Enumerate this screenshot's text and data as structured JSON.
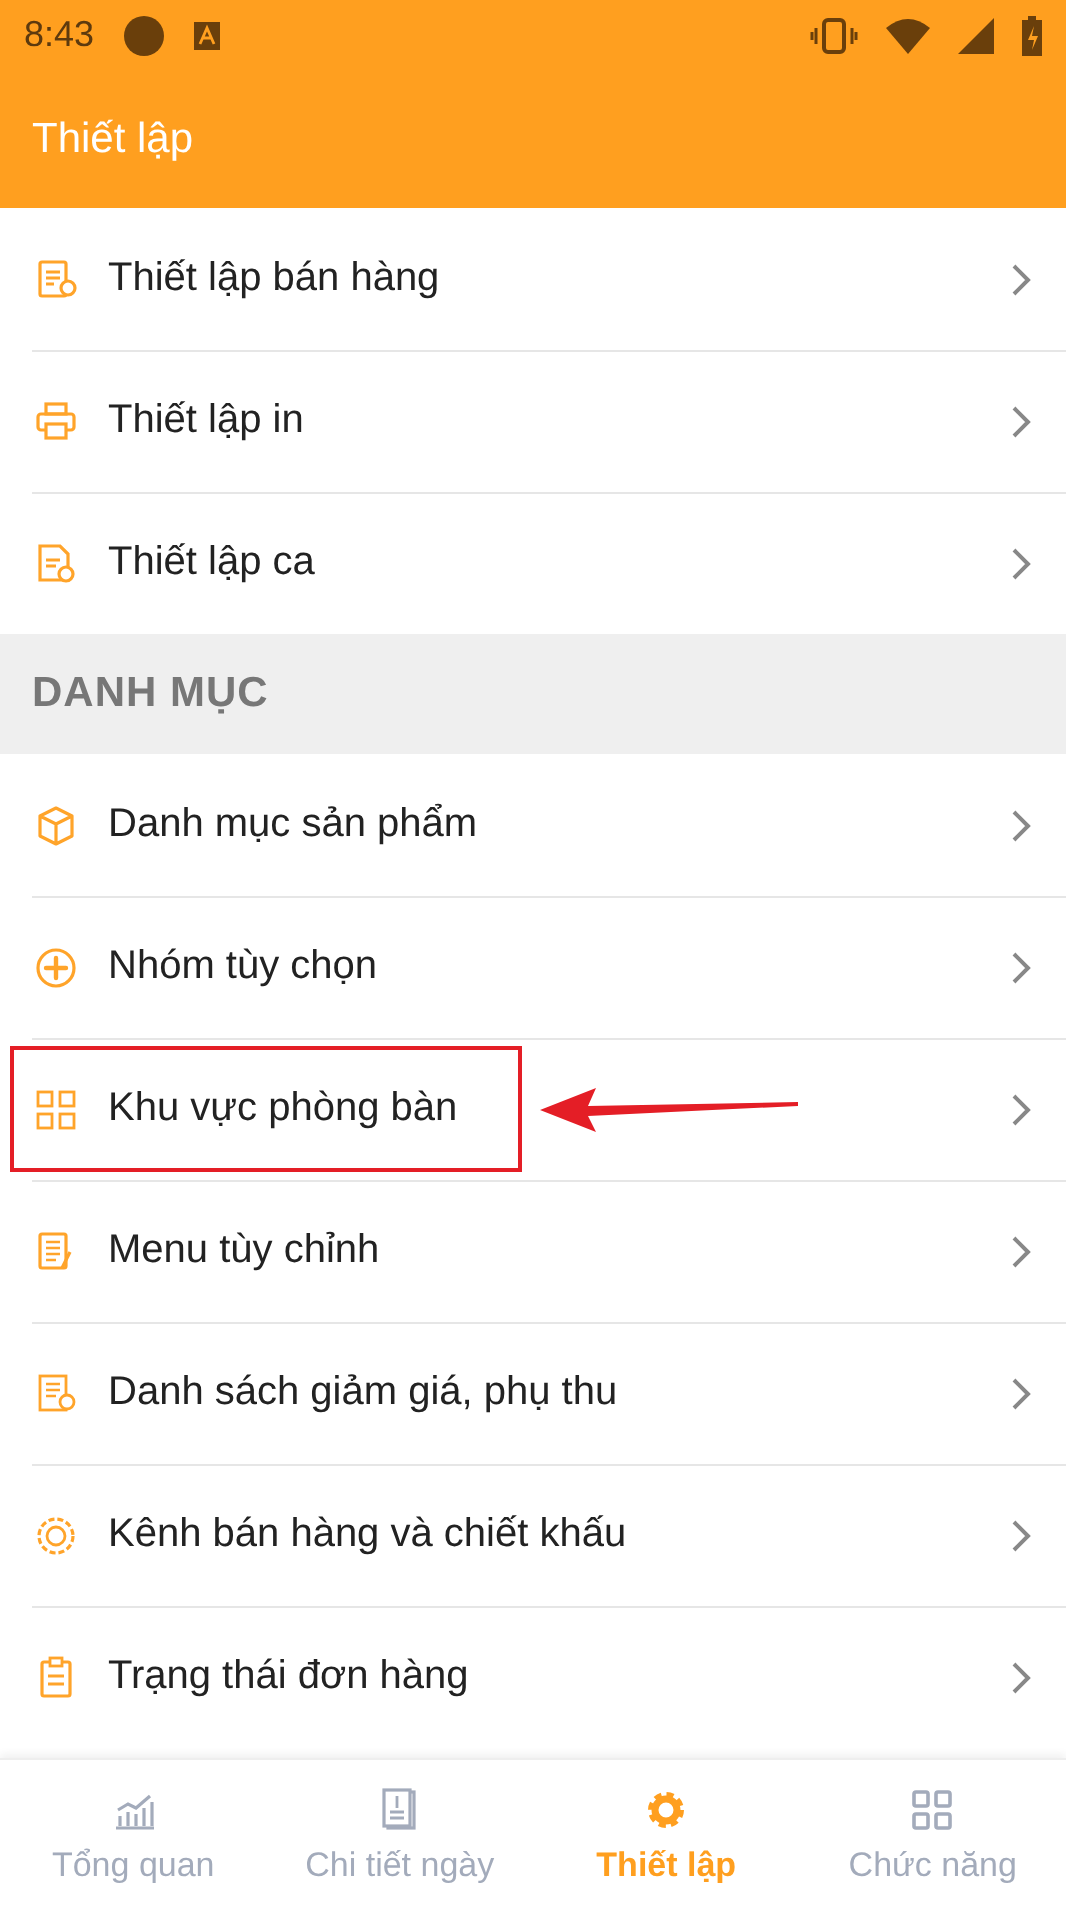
{
  "status_bar": {
    "time": "8:43"
  },
  "app_bar": {
    "title": "Thiết lập"
  },
  "sections": [
    {
      "items": [
        {
          "label": "Thiết lập bán hàng",
          "annotated": false
        },
        {
          "label": "Thiết lập in",
          "annotated": false
        },
        {
          "label": "Thiết lập ca",
          "annotated": false
        }
      ]
    },
    {
      "header": "DANH MỤC",
      "items": [
        {
          "label": "Danh mục sản phẩm",
          "annotated": false
        },
        {
          "label": "Nhóm tùy chọn",
          "annotated": false
        },
        {
          "label": "Khu vực phòng bàn",
          "annotated": true
        },
        {
          "label": "Menu tùy chỉnh",
          "annotated": false
        },
        {
          "label": "Danh sách giảm giá, phụ thu",
          "annotated": false
        },
        {
          "label": "Kênh bán hàng và chiết khấu",
          "annotated": false
        },
        {
          "label": "Trạng thái đơn hàng",
          "annotated": false
        }
      ]
    }
  ],
  "tabs": [
    {
      "label": "Tổng quan",
      "selected": false
    },
    {
      "label": "Chi tiết ngày",
      "selected": false
    },
    {
      "label": "Thiết lập",
      "selected": true
    },
    {
      "label": "Chức năng",
      "selected": false
    }
  ]
}
